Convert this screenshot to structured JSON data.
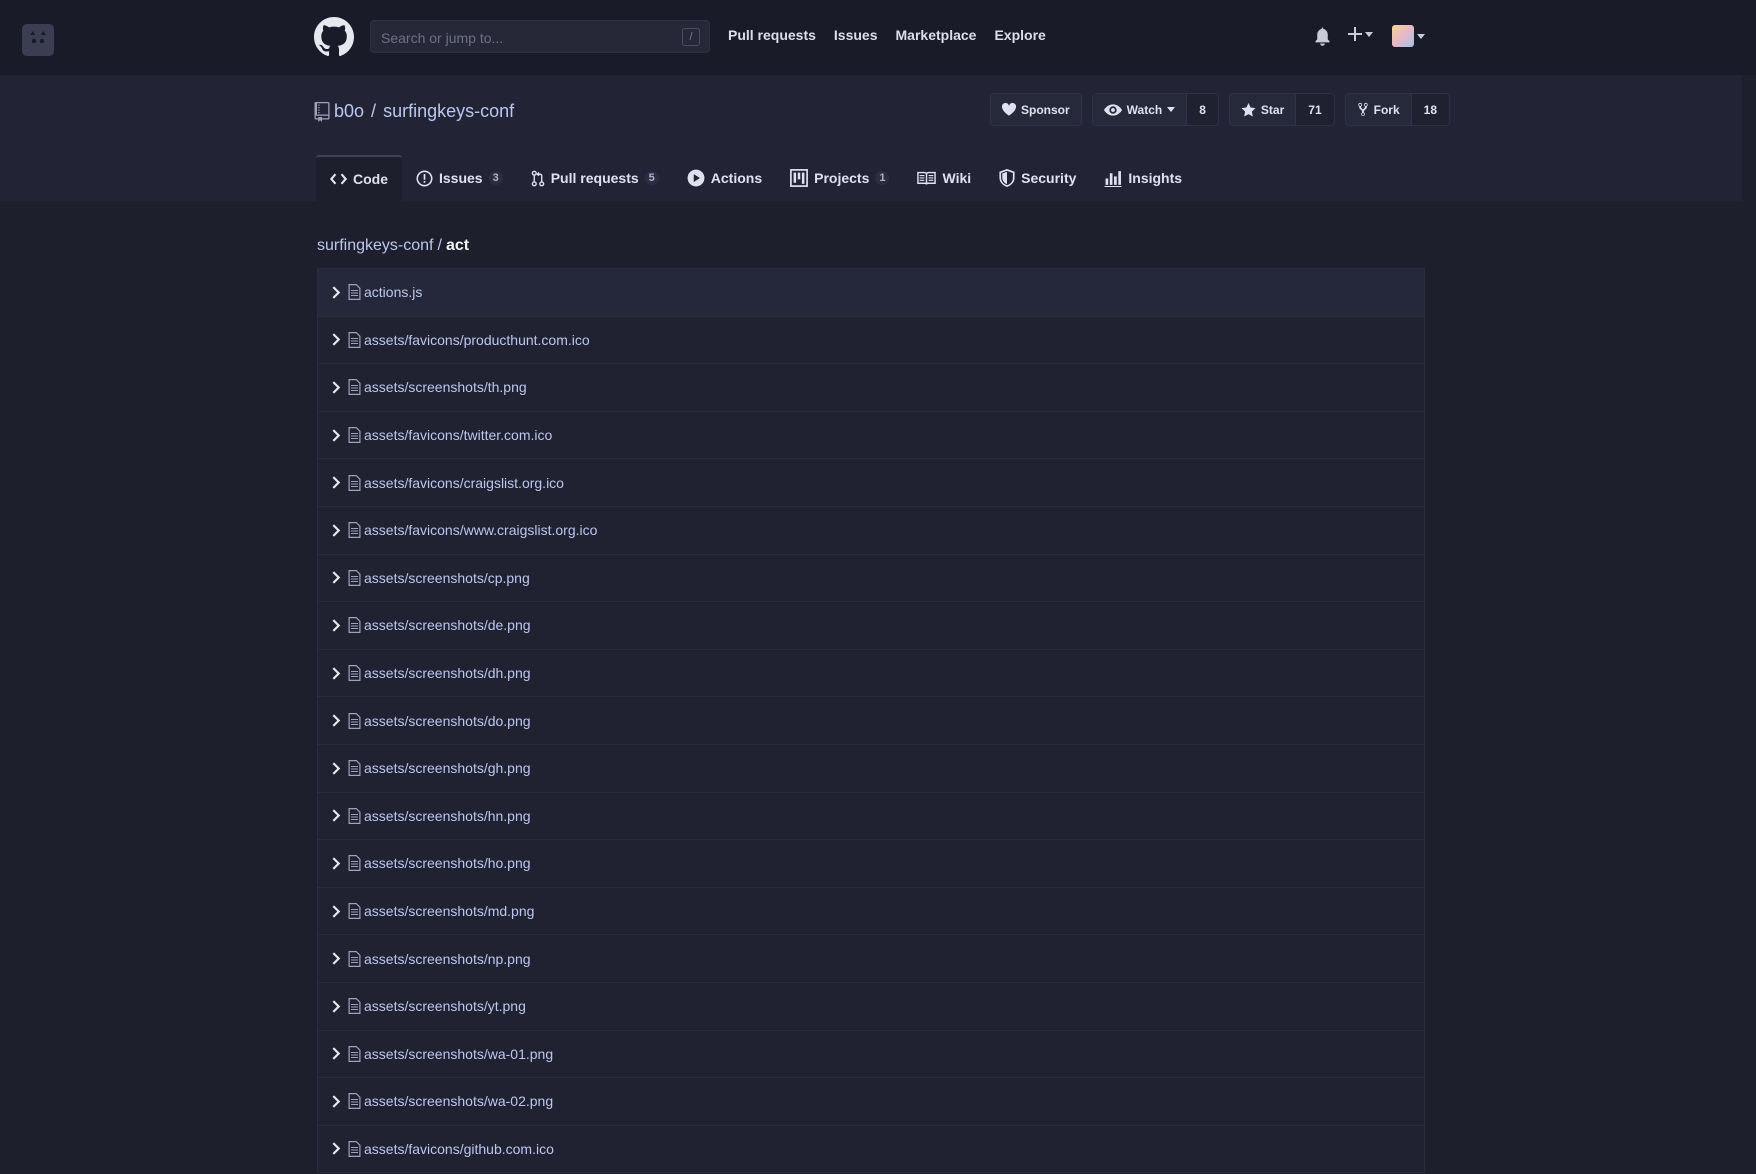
{
  "header": {
    "search_placeholder": "Search or jump to...",
    "search_shortcut": "/",
    "nav": [
      "Pull requests",
      "Issues",
      "Marketplace",
      "Explore"
    ]
  },
  "repo": {
    "owner": "b0o",
    "separator": "/",
    "name": "surfingkeys-conf",
    "sponsor_label": "Sponsor",
    "watch_label": "Watch",
    "watch_count": "8",
    "star_label": "Star",
    "star_count": "71",
    "fork_label": "Fork",
    "fork_count": "18"
  },
  "tabs": [
    {
      "label": "Code",
      "icon": "code-icon",
      "badge": ""
    },
    {
      "label": "Issues",
      "icon": "issue-icon",
      "badge": "3"
    },
    {
      "label": "Pull requests",
      "icon": "pull-request-icon",
      "badge": "5"
    },
    {
      "label": "Actions",
      "icon": "play-icon",
      "badge": ""
    },
    {
      "label": "Projects",
      "icon": "project-icon",
      "badge": "1"
    },
    {
      "label": "Wiki",
      "icon": "book-icon",
      "badge": ""
    },
    {
      "label": "Security",
      "icon": "shield-icon",
      "badge": ""
    },
    {
      "label": "Insights",
      "icon": "graph-icon",
      "badge": ""
    }
  ],
  "breadcrumb": {
    "root": "surfingkeys-conf",
    "separator": "/",
    "query": "act"
  },
  "files": [
    "actions.js",
    "assets/favicons/producthunt.com.ico",
    "assets/screenshots/th.png",
    "assets/favicons/twitter.com.ico",
    "assets/favicons/craigslist.org.ico",
    "assets/favicons/www.craigslist.org.ico",
    "assets/screenshots/cp.png",
    "assets/screenshots/de.png",
    "assets/screenshots/dh.png",
    "assets/screenshots/do.png",
    "assets/screenshots/gh.png",
    "assets/screenshots/hn.png",
    "assets/screenshots/ho.png",
    "assets/screenshots/md.png",
    "assets/screenshots/np.png",
    "assets/screenshots/yt.png",
    "assets/screenshots/wa-01.png",
    "assets/screenshots/wa-02.png",
    "assets/favicons/github.com.ico"
  ],
  "colors": {
    "background": "#1d1f2d",
    "header": "#1a1b28",
    "link": "#bcc7ef"
  }
}
